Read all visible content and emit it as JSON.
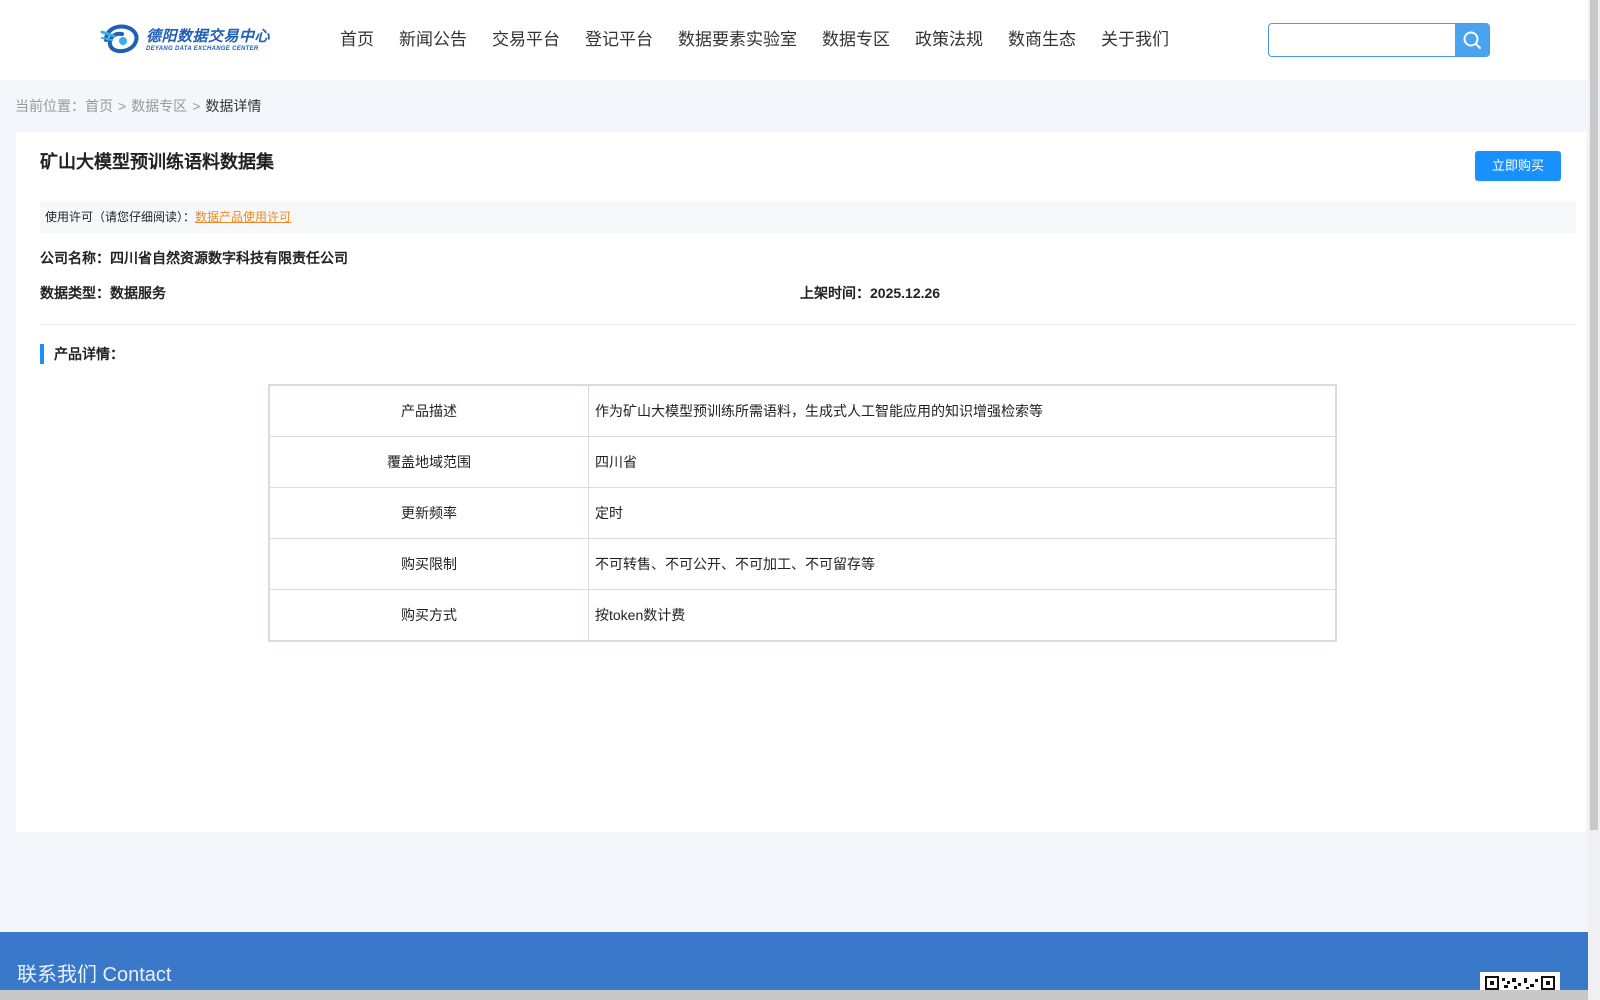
{
  "logo": {
    "name_cn": "德阳数据交易中心",
    "name_en": "DEYANG DATA EXCHANGE CENTER"
  },
  "nav": {
    "items": [
      {
        "label": "首页",
        "id": "home"
      },
      {
        "label": "新闻公告",
        "id": "news"
      },
      {
        "label": "交易平台",
        "id": "trade"
      },
      {
        "label": "登记平台",
        "id": "register"
      },
      {
        "label": "数据要素实验室",
        "id": "lab"
      },
      {
        "label": "数据专区",
        "id": "data-zone"
      },
      {
        "label": "政策法规",
        "id": "policy"
      },
      {
        "label": "数商生态",
        "id": "ecosystem"
      },
      {
        "label": "关于我们",
        "id": "about"
      }
    ]
  },
  "search": {
    "value": "",
    "placeholder": "",
    "icon": "search-icon"
  },
  "breadcrumb": {
    "prefix": "当前位置：",
    "items": [
      "首页",
      "数据专区"
    ],
    "separator": ">",
    "current": "数据详情"
  },
  "product": {
    "title": "矿山大模型预训练语料数据集",
    "buy_label": "立即购买",
    "license_label": "使用许可（请您仔细阅读）：",
    "license_link": "数据产品使用许可",
    "company_label": "公司名称：",
    "company": "四川省自然资源数字科技有限责任公司",
    "type_label": "数据类型：",
    "type": "数据服务",
    "listed_label": "上架时间：",
    "listed": "2025.12.26",
    "details_label": "产品详情："
  },
  "details": {
    "rows": [
      {
        "key": "产品描述",
        "value": "作为矿山大模型预训练所需语料，生成式人工智能应用的知识增强检索等"
      },
      {
        "key": "覆盖地域范围",
        "value": "四川省"
      },
      {
        "key": "更新频率",
        "value": "定时"
      },
      {
        "key": "购买限制",
        "value": "不可转售、不可公开、不可加工、不可留存等"
      },
      {
        "key": "购买方式",
        "value": "按token数计费"
      }
    ]
  },
  "footer": {
    "title": "联系我们 Contact"
  },
  "colors": {
    "accent": "#1890ff",
    "link": "#ef8a1f",
    "footer": "#3a78c9"
  }
}
